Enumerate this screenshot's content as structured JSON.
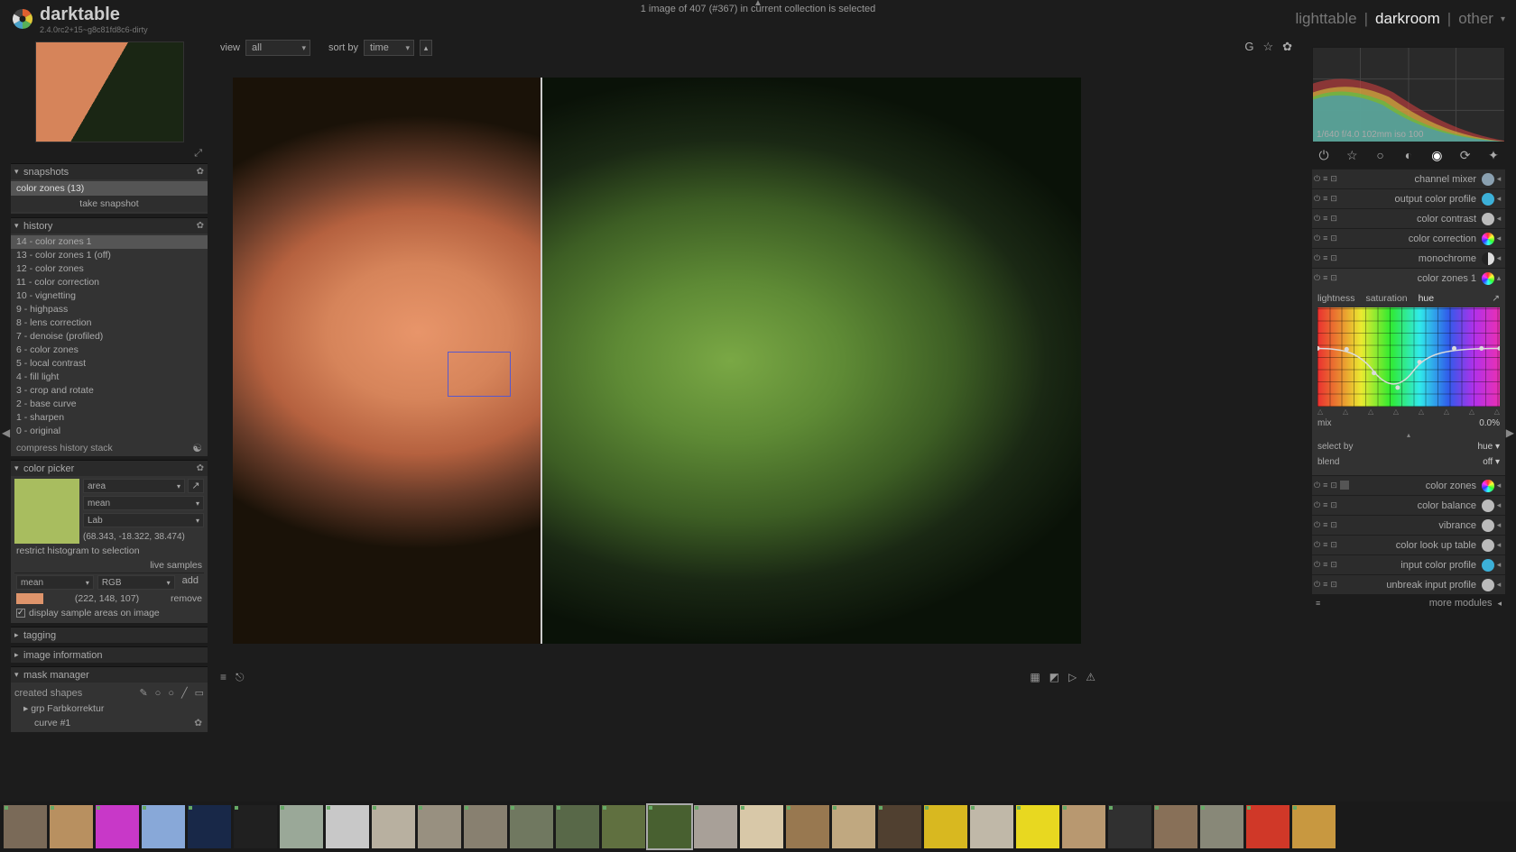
{
  "app": {
    "name": "darktable",
    "version": "2.4.0rc2+15~g8c81fd8c6-dirty"
  },
  "header": {
    "status": "1 image of 407 (#367) in current collection is selected",
    "views": {
      "lighttable": "lighttable",
      "darkroom": "darkroom",
      "other": "other"
    }
  },
  "subheader": {
    "view_label": "view",
    "view_value": "all",
    "sort_label": "sort by",
    "sort_value": "time"
  },
  "left": {
    "snapshots": {
      "title": "snapshots",
      "item": "color zones (13)",
      "take": "take snapshot"
    },
    "history": {
      "title": "history",
      "items": [
        "14 - color zones 1",
        "13 - color zones 1 (off)",
        "12 - color zones",
        "11 - color correction",
        "10 - vignetting",
        "9 - highpass",
        "8 - lens correction",
        "7 - denoise (profiled)",
        "6 - color zones",
        "5 - local contrast",
        "4 - fill light",
        "3 - crop and rotate",
        "2 - base curve",
        "1 - sharpen",
        "0 - original"
      ],
      "compress": "compress history stack"
    },
    "picker": {
      "title": "color picker",
      "mode": "area",
      "stat": "mean",
      "space": "Lab",
      "lab_value": "(68.343, -18.322, 38.474)",
      "restrict": "restrict histogram to selection",
      "live_samples": "live samples",
      "sample_mode": "mean",
      "sample_space": "RGB",
      "add": "add",
      "sample_value": "(222, 148, 107)",
      "remove": "remove",
      "display_chk": "display sample areas on image"
    },
    "tagging": {
      "title": "tagging"
    },
    "imginfo": {
      "title": "image information"
    },
    "mask": {
      "title": "mask manager",
      "created": "created shapes",
      "grp": "grp Farbkorrektur",
      "curve": "curve #1"
    }
  },
  "right": {
    "histo_info": "1/640 f/4.0 102mm iso 100",
    "modules": [
      {
        "name": "channel mixer",
        "color": "#8aa0b0"
      },
      {
        "name": "output color profile",
        "color": "#3cb0d8"
      },
      {
        "name": "color contrast",
        "color": "#bbb"
      },
      {
        "name": "color correction",
        "color": "conic-gradient(#f33,#ff3,#3f3,#3ff,#33f,#f3f,#f33)"
      },
      {
        "name": "monochrome",
        "color": "linear-gradient(90deg,#222 50%,#ddd 50%)"
      },
      {
        "name": "color zones 1",
        "color": "conic-gradient(#f33,#ff3,#3f3,#3ff,#33f,#f3f,#f33)",
        "expanded": true
      }
    ],
    "colorzones": {
      "tabs": {
        "lightness": "lightness",
        "saturation": "saturation",
        "hue": "hue"
      },
      "mix_label": "mix",
      "mix_value": "0.0%",
      "select_label": "select by",
      "select_value": "hue",
      "blend_label": "blend",
      "blend_value": "off"
    },
    "modules2": [
      {
        "name": "color zones",
        "color": "conic-gradient(#f33,#ff3,#3f3,#3ff,#33f,#f3f,#f33)"
      },
      {
        "name": "color balance",
        "color": "#bbb"
      },
      {
        "name": "vibrance",
        "color": "#bbb"
      },
      {
        "name": "color look up table",
        "color": "#bbb"
      },
      {
        "name": "input color profile",
        "color": "#3cb0d8"
      },
      {
        "name": "unbreak input profile",
        "color": "#bbb"
      }
    ],
    "more": "more modules"
  },
  "filmstrip_count": 29,
  "filmstrip_selected": 14
}
